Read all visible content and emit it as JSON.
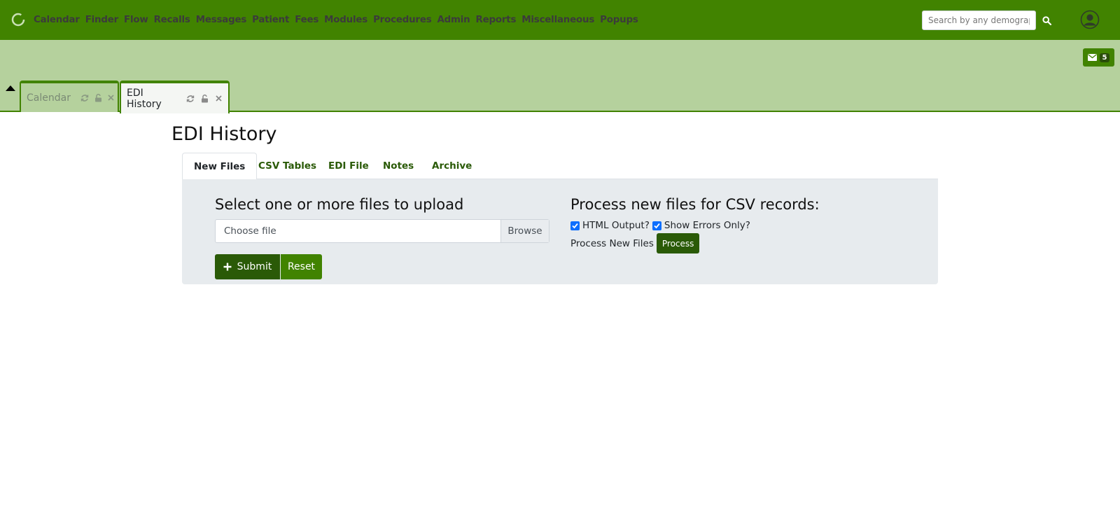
{
  "nav": {
    "menu": [
      "Calendar",
      "Finder",
      "Flow",
      "Recalls",
      "Messages",
      "Patient",
      "Fees",
      "Modules",
      "Procedures",
      "Admin",
      "Reports",
      "Miscellaneous",
      "Popups"
    ],
    "search_placeholder": "Search by any demographics"
  },
  "messages": {
    "count": "5"
  },
  "open_tabs": [
    {
      "label": "Calendar",
      "active": false
    },
    {
      "label": "EDI History",
      "active": true
    }
  ],
  "page": {
    "title": "EDI History",
    "tabs": [
      "New Files",
      "CSV Tables",
      "EDI File",
      "Notes",
      "Archive"
    ],
    "active_tab": "New Files"
  },
  "upload": {
    "heading": "Select one or more files to upload",
    "file_placeholder": "Choose file",
    "browse_label": "Browse",
    "submit_label": "Submit",
    "reset_label": "Reset"
  },
  "process": {
    "heading": "Process new files for CSV records:",
    "html_output_label": "HTML Output?",
    "html_output_checked": true,
    "errors_only_label": "Show Errors Only?",
    "errors_only_checked": true,
    "process_new_label": "Process New Files",
    "process_button": "Process"
  },
  "colors": {
    "nav_green": "#418300",
    "dark_green": "#2a5a07",
    "tab_area": "#b5d19d",
    "panel_bg": "#e7ebee",
    "checkbox_blue": "#0d6efd"
  }
}
